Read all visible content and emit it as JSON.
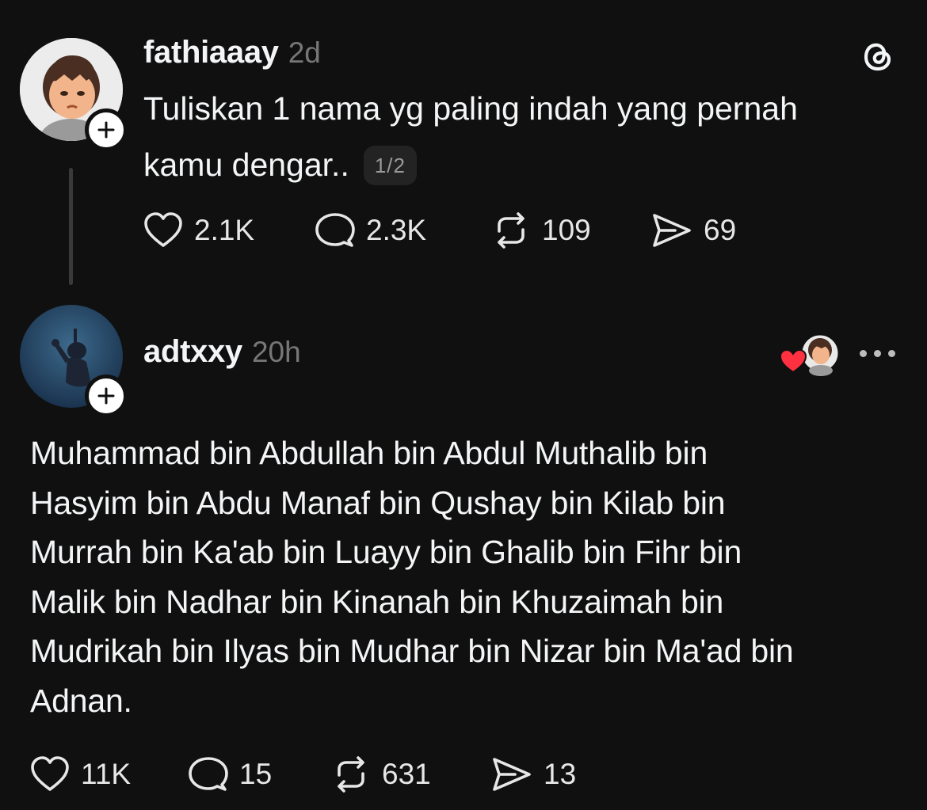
{
  "post": {
    "username": "fathiaaay",
    "time": "2d",
    "text_line1": "Tuliskan 1 nama yg paling indah yang pernah",
    "text_line2": "kamu dengar..",
    "page_indicator": "1/2",
    "avatar_icon": "cartoon-girl-avatar",
    "stats": {
      "likes": "2.1K",
      "comments": "2.3K",
      "reposts": "109",
      "shares": "69"
    }
  },
  "reply": {
    "username": "adtxxy",
    "time": "20h",
    "avatar_icon": "underwater-diver-avatar",
    "lines": [
      "Muhammad bin Abdullah bin Abdul Muthalib bin",
      "Hasyim bin Abdu Manaf bin Qushay bin Kilab bin",
      "Murrah bin Ka'ab bin Luayy bin Ghalib bin Fihr bin",
      "Malik bin Nadhar bin Kinanah bin Khuzaimah bin",
      "Mudrikah bin Ilyas bin Mudhar bin Nizar bin Ma'ad bin",
      "Adnan."
    ],
    "stats": {
      "likes": "11K",
      "comments": "15",
      "reposts": "631",
      "shares": "13"
    }
  },
  "icons": {
    "app_logo": "threads-logo-icon",
    "like": "heart-icon",
    "comment": "comment-bubble-icon",
    "repost": "repost-icon",
    "share": "send-icon",
    "follow": "plus-icon",
    "more": "more-dots-icon"
  },
  "colors": {
    "background": "#101010",
    "text": "#f3f5f7",
    "muted": "#777777",
    "like_red": "#ff3040"
  }
}
